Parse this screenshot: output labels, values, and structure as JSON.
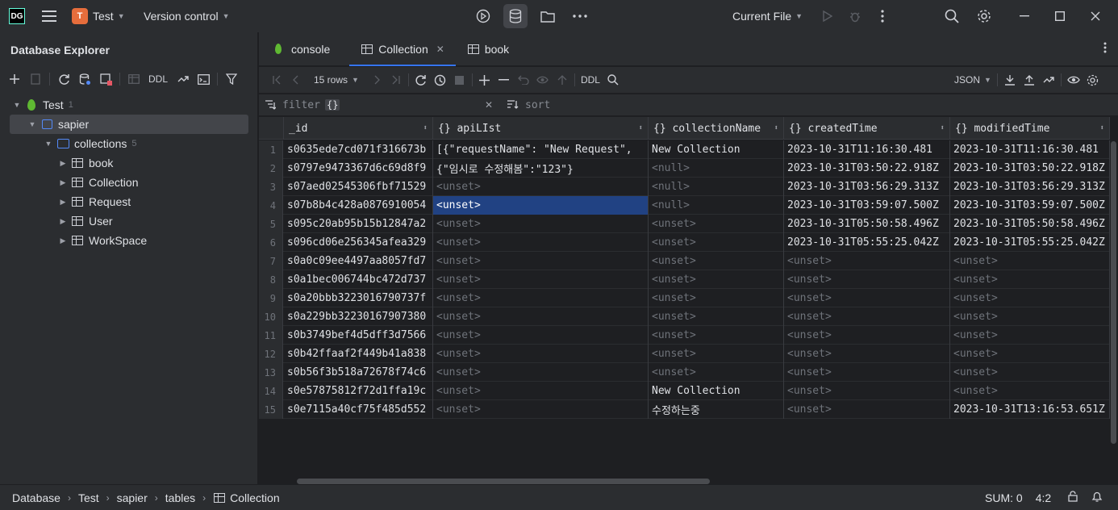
{
  "titlebar": {
    "app_logo": "DG",
    "project_initial": "T",
    "project_name": "Test",
    "vcs": "Version control",
    "run_config": "Current File"
  },
  "left_panel": {
    "title": "Database Explorer",
    "ddl_label": "DDL",
    "tree": {
      "root": {
        "label": "Test",
        "count": "1"
      },
      "schema": {
        "label": "sapier"
      },
      "folder": {
        "label": "collections",
        "count": "5"
      },
      "items": [
        {
          "label": "book"
        },
        {
          "label": "Collection"
        },
        {
          "label": "Request"
        },
        {
          "label": "User"
        },
        {
          "label": "WorkSpace"
        }
      ]
    }
  },
  "tabs": [
    {
      "label": "console",
      "icon": "leaf-icon"
    },
    {
      "label": "Collection",
      "icon": "table-icon"
    },
    {
      "label": "book",
      "icon": "table-icon"
    }
  ],
  "grid_toolbar": {
    "rows_label": "15 rows",
    "ddl_label": "DDL",
    "format_label": "JSON"
  },
  "filterbar": {
    "filter_label": "filter",
    "filter_value": "{}",
    "sort_label": "sort"
  },
  "grid": {
    "columns": [
      "_id",
      "{} apiLIst",
      "{} collectionName",
      "{} createdTime",
      "{} modifiedTime"
    ],
    "rows": [
      [
        "1",
        "s0635ede7cd071f316673b",
        "[{\"requestName\": \"New Request\",",
        "New Collection",
        "2023-10-31T11:16:30.481",
        "2023-10-31T11:16:30.481"
      ],
      [
        "2",
        "s0797e9473367d6c69d8f9",
        "{\"임시로 수정해봄\":\"123\"}",
        "<null>",
        "2023-10-31T03:50:22.918Z",
        "2023-10-31T03:50:22.918Z"
      ],
      [
        "3",
        "s07aed02545306fbf71529",
        "<unset>",
        "<null>",
        "2023-10-31T03:56:29.313Z",
        "2023-10-31T03:56:29.313Z"
      ],
      [
        "4",
        "s07b8b4c428a0876910054",
        "<unset>",
        "<null>",
        "2023-10-31T03:59:07.500Z",
        "2023-10-31T03:59:07.500Z"
      ],
      [
        "5",
        "s095c20ab95b15b12847a2",
        "<unset>",
        "<unset>",
        "2023-10-31T05:50:58.496Z",
        "2023-10-31T05:50:58.496Z"
      ],
      [
        "6",
        "s096cd06e256345afea329",
        "<unset>",
        "<unset>",
        "2023-10-31T05:55:25.042Z",
        "2023-10-31T05:55:25.042Z"
      ],
      [
        "7",
        "s0a0c09ee4497aa8057fd7",
        "<unset>",
        "<unset>",
        "<unset>",
        "<unset>"
      ],
      [
        "8",
        "s0a1bec006744bc472d737",
        "<unset>",
        "<unset>",
        "<unset>",
        "<unset>"
      ],
      [
        "9",
        "s0a20bbb3223016790737f",
        "<unset>",
        "<unset>",
        "<unset>",
        "<unset>"
      ],
      [
        "10",
        "s0a229bb32230167907380",
        "<unset>",
        "<unset>",
        "<unset>",
        "<unset>"
      ],
      [
        "11",
        "s0b3749bef4d5dff3d7566",
        "<unset>",
        "<unset>",
        "<unset>",
        "<unset>"
      ],
      [
        "12",
        "s0b42ffaaf2f449b41a838",
        "<unset>",
        "<unset>",
        "<unset>",
        "<unset>"
      ],
      [
        "13",
        "s0b56f3b518a72678f74c6",
        "<unset>",
        "<unset>",
        "<unset>",
        "<unset>"
      ],
      [
        "14",
        "s0e57875812f72d1ffa19c",
        "<unset>",
        "New Collection",
        "<unset>",
        "<unset>"
      ],
      [
        "15",
        "s0e7115a40cf75f485d552",
        "<unset>",
        "수정하는중",
        "<unset>",
        "2023-10-31T13:16:53.651Z"
      ]
    ],
    "selected_cell": {
      "row": 4,
      "column": "apiLIst"
    }
  },
  "statusbar": {
    "breadcrumbs": [
      "Database",
      "Test",
      "sapier",
      "tables",
      "Collection"
    ],
    "sum": "SUM: 0",
    "position": "4:2"
  },
  "colors": {
    "accent": "#3574f0",
    "selection": "#214283",
    "mongo_leaf": "#5fb832",
    "project_badge": "#e66d3c"
  }
}
